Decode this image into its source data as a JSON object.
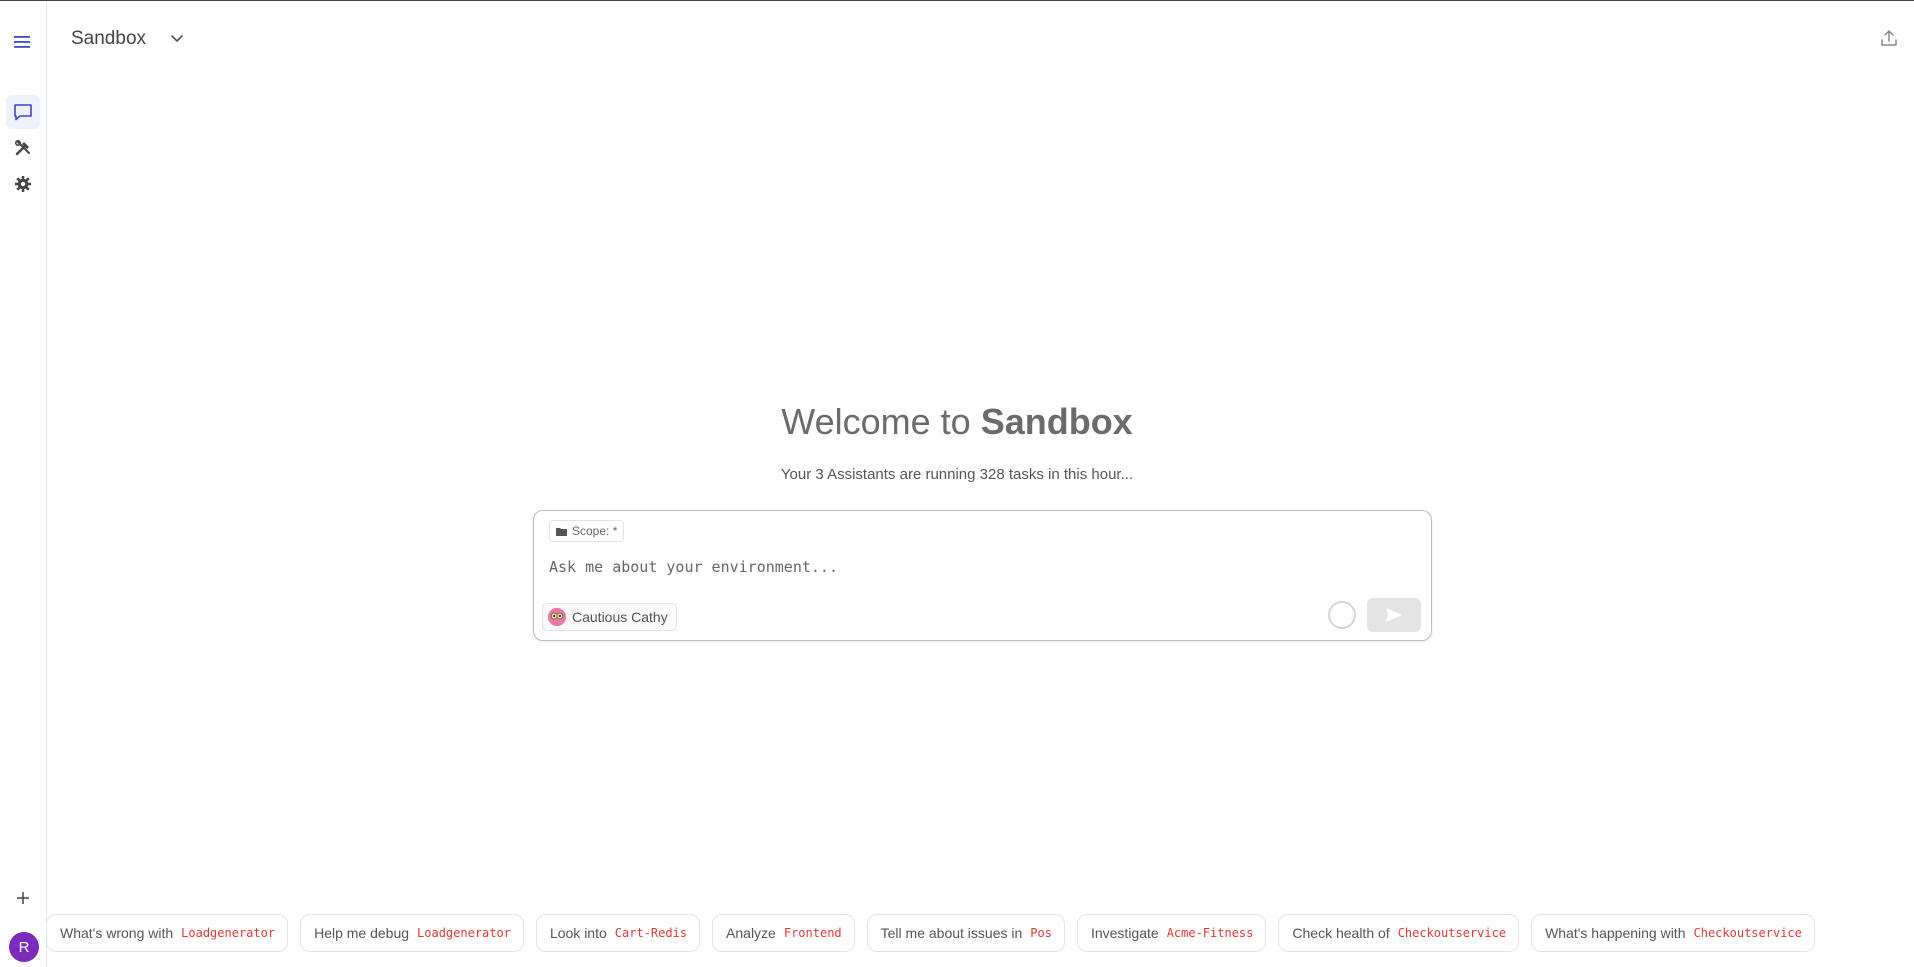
{
  "workspace": {
    "name": "Sandbox"
  },
  "sidebar": {
    "items": [
      {
        "icon": "menu-icon"
      },
      {
        "icon": "chat-icon",
        "active": true
      },
      {
        "icon": "tools-icon"
      },
      {
        "icon": "gear-icon"
      }
    ],
    "avatar_initial": "R"
  },
  "welcome": {
    "prefix": "Welcome to ",
    "name": "Sandbox",
    "subtitle": "Your 3 Assistants are running 328 tasks in this hour..."
  },
  "composer": {
    "scope_label": "Scope: *",
    "placeholder": "Ask me about your environment...",
    "assistant_name": "Cautious Cathy"
  },
  "suggestions": [
    {
      "text": "What's wrong with",
      "tag": "Loadgenerator"
    },
    {
      "text": "Help me debug",
      "tag": "Loadgenerator"
    },
    {
      "text": "Look into",
      "tag": "Cart-Redis"
    },
    {
      "text": "Analyze",
      "tag": "Frontend"
    },
    {
      "text": "Tell me about issues in",
      "tag": "Pos"
    },
    {
      "text": "Investigate",
      "tag": "Acme-Fitness"
    },
    {
      "text": "Check health of",
      "tag": "Checkoutservice"
    },
    {
      "text": "What's happening with",
      "tag": "Checkoutservice"
    }
  ],
  "colors": {
    "accent": "#3b48c7",
    "tag": "#e53935",
    "avatar": "#7b2cbf"
  }
}
